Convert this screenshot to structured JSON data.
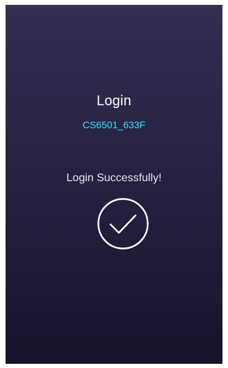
{
  "header": {
    "title": "Login",
    "device_name": "CS6501_633F"
  },
  "status": {
    "message": "Login Successfully!",
    "icon": "checkmark-circle-icon"
  },
  "colors": {
    "background_top": "#332f53",
    "background_bottom": "#16142b",
    "accent": "#2ee0ff",
    "text": "#ffffff"
  }
}
